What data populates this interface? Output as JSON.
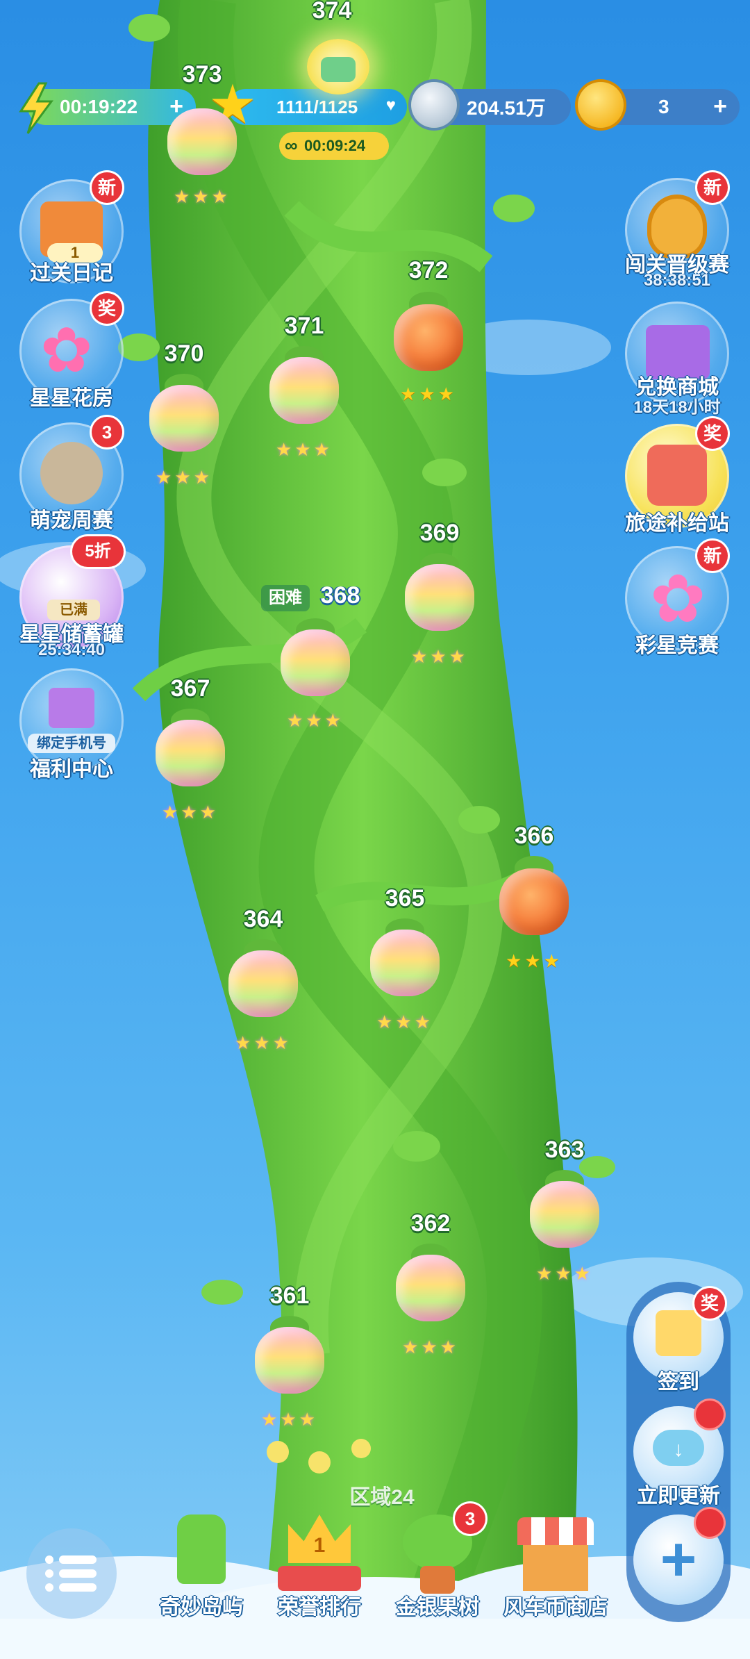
{
  "top_bar": {
    "energy_timer": "00:19:22",
    "stars": "1111/1125",
    "coins": "204.51万",
    "gold": "3",
    "infinite_timer": "00:09:24"
  },
  "left_menu": [
    {
      "label": "过关日记",
      "badge": "新",
      "sub": "1"
    },
    {
      "label": "星星花房",
      "badge": "奖"
    },
    {
      "label": "萌宠周赛",
      "badge": "3"
    },
    {
      "label": "星星储蓄罐",
      "badge": "5折",
      "sub": "25:34:40",
      "tag": "已满"
    },
    {
      "label": "福利中心",
      "tag": "绑定手机号"
    }
  ],
  "right_menu": [
    {
      "label": "闯关晋级赛",
      "badge": "新",
      "sub": "38:38:51"
    },
    {
      "label": "兑换商城",
      "sub": "18天18小时"
    },
    {
      "label": "旅途补给站",
      "badge": "奖"
    },
    {
      "label": "彩星竞赛",
      "badge": "新"
    }
  ],
  "levels": [
    {
      "num": "374",
      "stars": "",
      "style": "current"
    },
    {
      "num": "373",
      "stars": "★★★",
      "style": "rainbow"
    },
    {
      "num": "372",
      "stars": "★★★",
      "style": "gold"
    },
    {
      "num": "371",
      "stars": "★★★",
      "style": "rainbow"
    },
    {
      "num": "370",
      "stars": "★★★",
      "style": "rainbow"
    },
    {
      "num": "369",
      "stars": "★★★",
      "style": "rainbow"
    },
    {
      "num": "368",
      "stars": "★★★",
      "style": "rainbow",
      "tag": "困难"
    },
    {
      "num": "367",
      "stars": "★★★",
      "style": "rainbow"
    },
    {
      "num": "366",
      "stars": "★★★",
      "style": "gold"
    },
    {
      "num": "365",
      "stars": "★★★",
      "style": "rainbow"
    },
    {
      "num": "364",
      "stars": "★★★",
      "style": "rainbow"
    },
    {
      "num": "363",
      "stars": "★★★",
      "style": "rainbow"
    },
    {
      "num": "362",
      "stars": "★★★",
      "style": "rainbow"
    },
    {
      "num": "361",
      "stars": "★★★",
      "style": "rainbow"
    }
  ],
  "area_label": "区域24",
  "bottom_nav": [
    {
      "label": "奇妙岛屿"
    },
    {
      "label": "荣誉排行",
      "rank": "1"
    },
    {
      "label": "金银果树",
      "badge": "3"
    },
    {
      "label": "风车币商店"
    }
  ],
  "right_panel": [
    {
      "label": "签到",
      "badge": "奖"
    },
    {
      "label": "立即更新"
    },
    {
      "label": ""
    }
  ],
  "colors": {
    "sky": "#2a8ee4",
    "stalk": "#5fc33c",
    "badge": "#e8343a"
  }
}
